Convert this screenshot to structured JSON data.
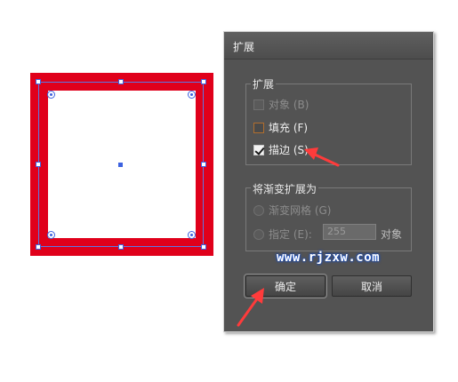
{
  "dialog": {
    "title": "扩展",
    "expand_group": {
      "label": "扩展",
      "object": "对象 (B)",
      "fill": "填充 (F)",
      "stroke": "描边 (S)"
    },
    "gradient_group": {
      "label": "将渐变扩展为",
      "gradient_mesh": "渐变网格 (G)",
      "specify": "指定 (E):",
      "specify_value": "255",
      "specify_unit": "对象"
    },
    "ok_label": "确定",
    "cancel_label": "取消"
  },
  "watermark": "www.rjzxw.com",
  "colors": {
    "artwork_stroke": "#e0001b",
    "selection": "#3d62e0",
    "dialog_bg": "#535353",
    "annotation_arrow": "#ff3b3b"
  }
}
